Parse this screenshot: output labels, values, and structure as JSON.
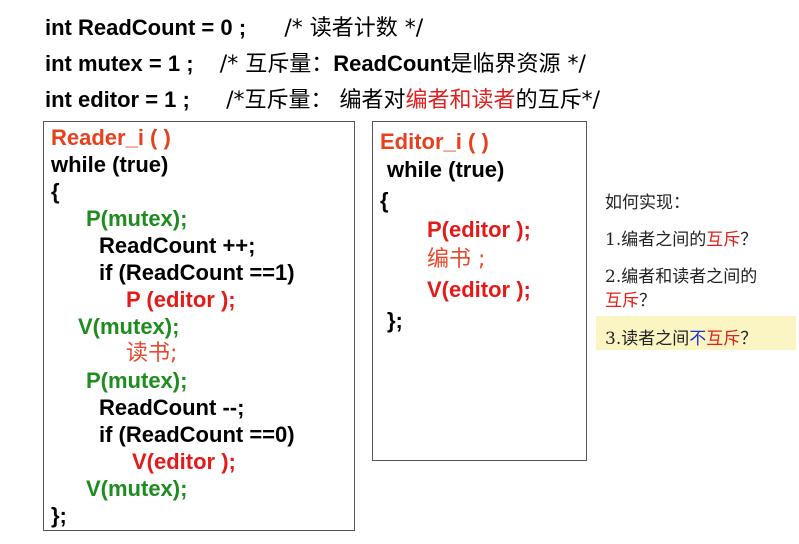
{
  "header": {
    "line1": {
      "code": "int ReadCount = 0 ;",
      "comment": "/* 读者计数 */"
    },
    "line2": {
      "code": "int mutex = 1 ;",
      "c1": "/* 互斥量：",
      "c2": "ReadCount",
      "c3": "是临界资源 */"
    },
    "line3": {
      "code": "int editor = 1 ;",
      "c1": "/*互斥量：",
      "c2": "编者对",
      "c3": "编者和读者",
      "c4": "的互斥*/"
    }
  },
  "reader": {
    "title": "Reader_i (   )",
    "lines": [
      "while (true)",
      "{",
      "P(mutex);",
      "ReadCount ++;",
      "if (ReadCount ==1)",
      "P (editor );",
      "V(mutex);",
      "读书;",
      "P(mutex);",
      "ReadCount --;",
      "if (ReadCount ==0)",
      "V(editor );",
      "V(mutex);",
      "};"
    ]
  },
  "editor": {
    "title": "Editor_i (  )",
    "lines": [
      "while (true)",
      "{",
      "P(editor );",
      "编书 ;",
      "V(editor );",
      "};"
    ]
  },
  "side": {
    "heading": "如何实现：",
    "q1a": "1.编者之间的",
    "q1b": "互斥",
    "q1c": "？",
    "q2a": "2.编者和读者之间的",
    "q2b": "互斥",
    "q2c": "？",
    "q3a": "3.读者之间",
    "q3b": "不",
    "q3c": "互斥",
    "q3d": "？"
  },
  "colors": {
    "red": "#e61919",
    "green": "#1e8c1e",
    "highlight": "#fbf5c4",
    "blue": "#1a2fd4"
  }
}
